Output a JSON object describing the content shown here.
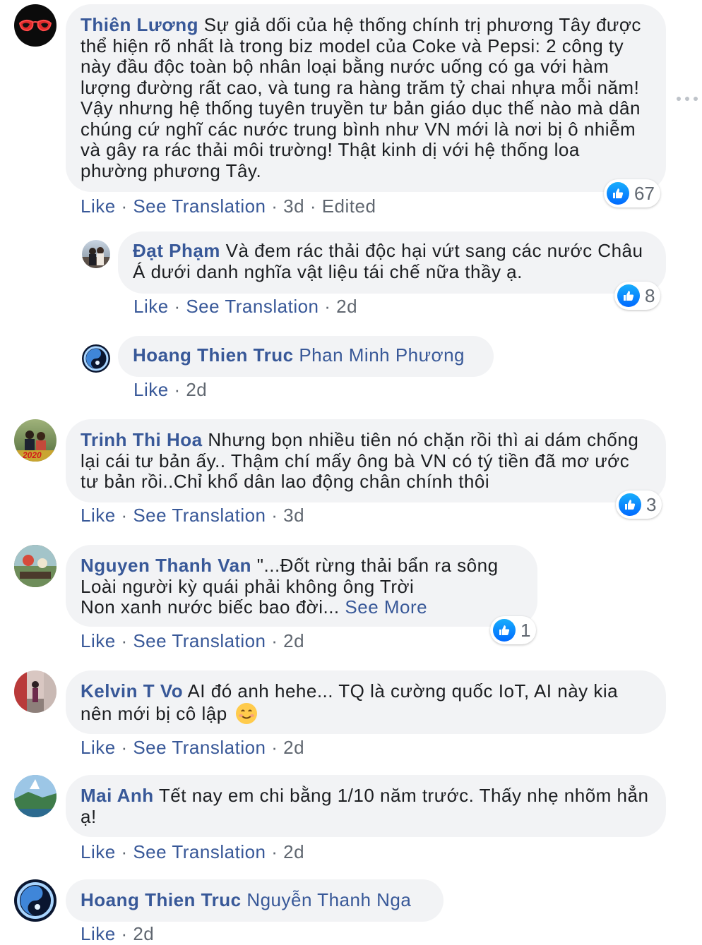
{
  "comments": [
    {
      "author": "Thiên Lương",
      "text": "Sự giả dối của hệ thống chính trị phương Tây được thể hiện rõ nhất là trong biz model của Coke và Pepsi: 2 công ty này đầu độc toàn bộ nhân loại bằng nước uống có ga với hàm lượng đường rất cao, và tung ra hàng trăm tỷ chai nhựa mỗi năm! Vậy nhưng hệ thống tuyên truyền tư bản giáo dục thế nào mà dân chúng cứ nghĩ các nước trung bình như VN mới là nơi bị ô nhiễm và gây ra rác thải môi trường! Thật kinh dị với hệ thống loa phường phương Tây.",
      "like": "Like",
      "translate": "See Translation",
      "time": "3d",
      "edited": "Edited",
      "reactions": "67",
      "replies": [
        {
          "author": "Đạt Phạm",
          "text": "Và đem rác thải độc hại vứt sang các nước Châu Á dưới danh nghĩa vật liệu tái chế nữa thầy ạ.",
          "like": "Like",
          "translate": "See Translation",
          "time": "2d",
          "reactions": "8"
        },
        {
          "author": "Hoang Thien Truc",
          "mention": "Phan Minh Phương",
          "like": "Like",
          "time": "2d"
        }
      ]
    },
    {
      "author": "Trinh Thi Hoa",
      "text": "Nhưng bọn nhiều tiên nó chặn rồi thì ai dám chống lại cái tư bản ấy.. Thậm chí mấy ông bà VN có tý tiền đã mơ ước tư bản rồi..Chỉ khổ dân lao động chân chính thôi",
      "like": "Like",
      "translate": "See Translation",
      "time": "3d",
      "reactions": "3",
      "avatar_badge": "2020"
    },
    {
      "author": "Nguyen Thanh Van",
      "lines": [
        "\"...Đốt rừng thải bẩn ra sông",
        "Loài người kỳ quái phải không ông Trời",
        "Non xanh nước biếc bao đời..."
      ],
      "see_more": "See More",
      "like": "Like",
      "translate": "See Translation",
      "time": "2d",
      "reactions": "1"
    },
    {
      "author": "Kelvin T Vo",
      "text": "AI đó anh hehe... TQ là cường quốc IoT, AI này kia nên mới bị cô lập",
      "like": "Like",
      "translate": "See Translation",
      "time": "2d"
    },
    {
      "author": "Mai Anh",
      "text": "Tết nay em chi bằng 1/10 năm trước. Thấy nhẹ nhõm hẳn ạ!",
      "like": "Like",
      "translate": "See Translation",
      "time": "2d"
    },
    {
      "author": "Hoang Thien Truc",
      "mention": "Nguyễn Thanh Nga",
      "like": "Like",
      "time": "2d"
    }
  ],
  "separator": "·",
  "icons": {
    "reaction": "like-thumb-icon",
    "menu": "more-options-icon",
    "emoji": "smiling-face-icon"
  },
  "colors": {
    "link": "#385898",
    "bubble": "#f2f3f5",
    "meta": "#606770",
    "like_blue": "#1877f2"
  }
}
